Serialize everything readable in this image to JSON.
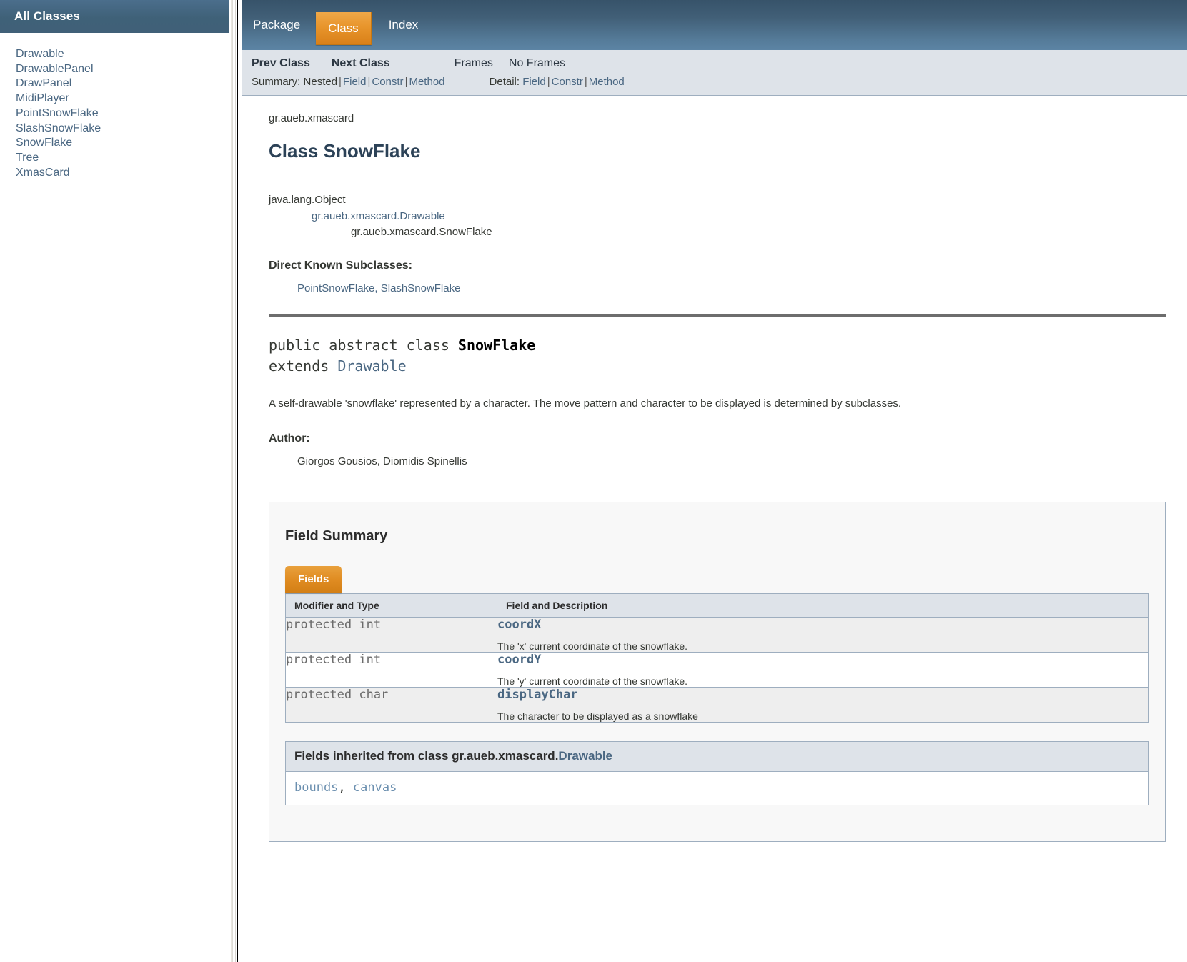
{
  "sidebar": {
    "title": "All Classes",
    "classes": [
      "Drawable",
      "DrawablePanel",
      "DrawPanel",
      "MidiPlayer",
      "PointSnowFlake",
      "SlashSnowFlake",
      "SnowFlake",
      "Tree",
      "XmasCard"
    ]
  },
  "topnav": {
    "items": [
      {
        "label": "Package",
        "active": false
      },
      {
        "label": "Class",
        "active": true
      },
      {
        "label": "Index",
        "active": false
      }
    ]
  },
  "subnav": {
    "prev_class": "Prev Class",
    "next_class": "Next Class",
    "frames": "Frames",
    "no_frames": "No Frames",
    "summary_label": "Summary:",
    "summary_items": [
      "Nested",
      "Field",
      "Constr",
      "Method"
    ],
    "detail_label": "Detail:",
    "detail_items": [
      "Field",
      "Constr",
      "Method"
    ],
    "separator": "|"
  },
  "header": {
    "package": "gr.aueb.xmascard",
    "class_title": "Class SnowFlake"
  },
  "inheritance": {
    "level0": "java.lang.Object",
    "level1": "gr.aueb.xmascard.Drawable",
    "level2": "gr.aueb.xmascard.SnowFlake"
  },
  "subclasses": {
    "label": "Direct Known Subclasses:",
    "value": "PointSnowFlake, SlashSnowFlake"
  },
  "declaration": {
    "modifiers": "public abstract class ",
    "name": "SnowFlake",
    "extends_keyword": "extends ",
    "extends_type": "Drawable"
  },
  "description": "A self-drawable 'snowflake' represented by a character. The move pattern and character to be displayed is determined by subclasses.",
  "author": {
    "label": "Author:",
    "value": "Giorgos Gousios, Diomidis Spinellis"
  },
  "field_summary": {
    "heading": "Field Summary",
    "tab_label": "Fields",
    "columns": [
      "Modifier and Type",
      "Field and Description"
    ],
    "rows": [
      {
        "type": "protected int",
        "name": "coordX",
        "description": "The 'x' current coordinate of the snowflake."
      },
      {
        "type": "protected int",
        "name": "coordY",
        "description": "The 'y' current coordinate of the snowflake."
      },
      {
        "type": "protected char",
        "name": "displayChar",
        "description": "The character to be displayed as a snowflake"
      }
    ]
  },
  "inherited_fields": {
    "heading_prefix": "Fields inherited from class gr.aueb.xmascard.",
    "heading_link": "Drawable",
    "fields": [
      "bounds",
      "canvas"
    ],
    "separator": ", "
  },
  "colors": {
    "nav_dark": "#37536a",
    "nav_light": "#5c84a4",
    "accent_orange": "#e08c22",
    "link_blue": "#4a6782",
    "header_blue": "#2c4257",
    "table_header_bg": "#dee3e9",
    "border_blue": "#9eaebf",
    "alt_row": "#eeeeee"
  }
}
